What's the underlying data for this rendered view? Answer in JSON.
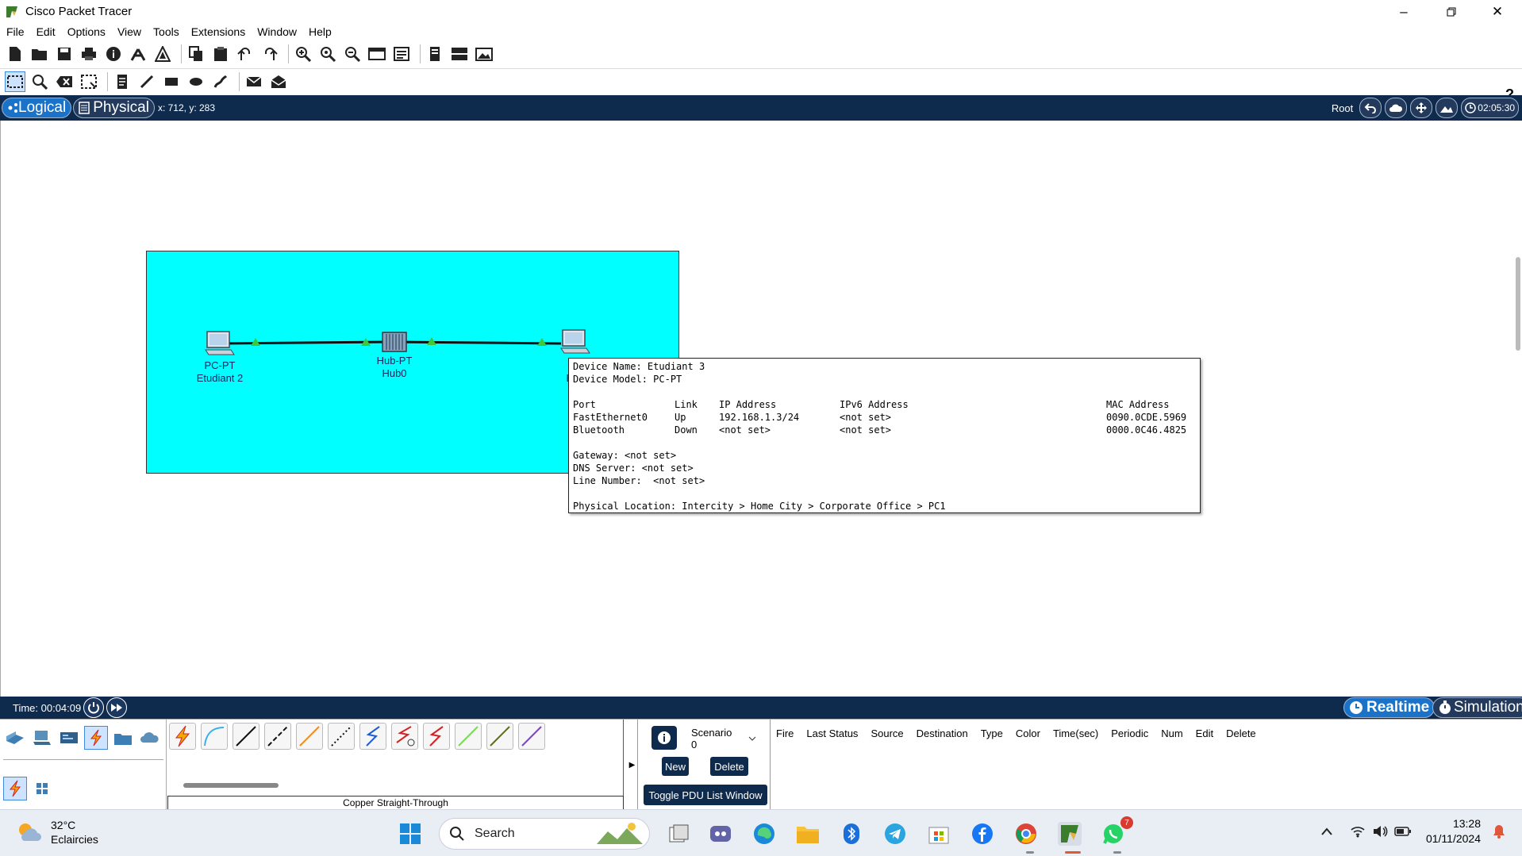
{
  "window": {
    "title": "Cisco Packet Tracer"
  },
  "menu": [
    "File",
    "Edit",
    "Options",
    "View",
    "Tools",
    "Extensions",
    "Window",
    "Help"
  ],
  "toolbar": {
    "help_label": "?"
  },
  "nav": {
    "logical_label": "Logical",
    "physical_label": "Physical",
    "coords": "x: 712, y: 283",
    "root_label": "Root",
    "clock": "02:05:30"
  },
  "devices": [
    {
      "type": "PC-PT",
      "name": "Etudiant 2"
    },
    {
      "type": "Hub-PT",
      "name": "Hub0"
    },
    {
      "type": "P",
      "name": "Etu"
    }
  ],
  "tooltip": {
    "device_name": "Device Name: Etudiant 3",
    "device_model": "Device Model: PC-PT",
    "headers": [
      "Port",
      "Link",
      "IP Address",
      "IPv6 Address",
      "MAC Address"
    ],
    "ports": [
      [
        "FastEthernet0",
        "Up",
        "192.168.1.3/24",
        "<not set>",
        "0090.0CDE.5969"
      ],
      [
        "Bluetooth",
        "Down",
        "<not set>",
        "<not set>",
        "0000.0C46.4825"
      ]
    ],
    "gateway": "Gateway: <not set>",
    "dns": "DNS Server: <not set>",
    "line_number": "Line Number:  <not set>",
    "location": "Physical Location: Intercity > Home City > Corporate Office > PC1"
  },
  "sim": {
    "time": "Time: 00:04:09",
    "realtime_label": "Realtime",
    "simulation_label": "Simulation"
  },
  "cables": {
    "selected_label": "Copper Straight-Through",
    "items": [
      "automatic-cable",
      "console-cable",
      "copper-straight-through",
      "copper-cross-over",
      "fiber-cable",
      "phone-cable",
      "coaxial-cable",
      "serial-dce-cable",
      "serial-dte-cable",
      "octal-cable",
      "iot-custom-cable",
      "usb-cable",
      "green-cable"
    ]
  },
  "scenario": {
    "selected": "Scenario 0",
    "new_label": "New",
    "delete_label": "Delete",
    "toggle_label": "Toggle PDU List Window"
  },
  "pdu_columns": [
    "Fire",
    "Last Status",
    "Source",
    "Destination",
    "Type",
    "Color",
    "Time(sec)",
    "Periodic",
    "Num",
    "Edit",
    "Delete"
  ],
  "taskbar": {
    "temperature": "32°C",
    "weather": "Eclaircies",
    "search_label": "Search",
    "whatsapp_badge": "7",
    "time": "13:28",
    "date": "01/11/2024"
  },
  "colors": {
    "cluster_bg": "#00ffff",
    "nav_bg": "#0e2a4d",
    "link_up": "#3ec83e"
  }
}
